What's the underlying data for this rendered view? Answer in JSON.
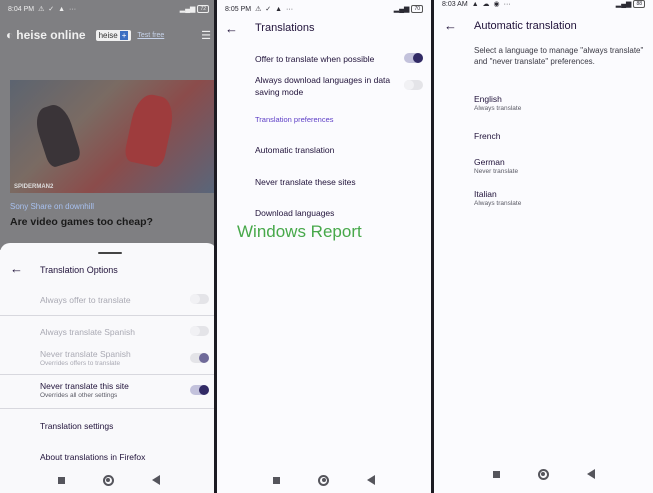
{
  "left_panel": {
    "status": {
      "time": "8:04 PM",
      "icons": "⚠ ✓ ▲",
      "more": "···",
      "battery": "72"
    },
    "webpage": {
      "site_name": "heise online",
      "plus_label": "heise",
      "plus_badge": "+",
      "test_free": "Test free",
      "image_watermark": "SPIDERMAN2",
      "kicker": "Sony Share on downhill",
      "headline": "Are video games too cheap?"
    },
    "sheet": {
      "title": "Translation Options",
      "rows": [
        {
          "title": "Always offer to translate",
          "subtitle": "",
          "toggle": "off",
          "dim": true
        },
        {
          "title": "Always translate Spanish",
          "subtitle": "",
          "toggle": "off",
          "dim": true
        },
        {
          "title": "Never translate Spanish",
          "subtitle": "Overrides offers to translate",
          "toggle": "on",
          "dim": true
        },
        {
          "title": "Never translate this site",
          "subtitle": "Overrides all other settings",
          "toggle": "on",
          "dim": false
        }
      ],
      "links": [
        "Translation settings",
        "About translations in Firefox"
      ]
    }
  },
  "middle_panel": {
    "status": {
      "time": "8:05 PM",
      "icons": "⚠ ✓ ▲",
      "more": "···",
      "battery": "70"
    },
    "title": "Translations",
    "settings": [
      {
        "label": "Offer to translate when possible",
        "toggle": "on"
      },
      {
        "label": "Always download languages in data saving mode",
        "toggle": "off"
      }
    ],
    "section_header": "Translation preferences",
    "items": [
      "Automatic translation",
      "Never translate these sites",
      "Download languages"
    ],
    "watermark": "Windows Report"
  },
  "right_panel": {
    "status": {
      "time": "8:03 AM",
      "icons": "▲ ☁ ◉",
      "more": "···",
      "battery": "88"
    },
    "title": "Automatic translation",
    "description": "Select a language to manage \"always translate\" and \"never translate\" preferences.",
    "languages": [
      {
        "name": "English",
        "status": "Always translate"
      },
      {
        "name": "French",
        "status": ""
      },
      {
        "name": "German",
        "status": "Never translate"
      },
      {
        "name": "Italian",
        "status": "Always translate"
      }
    ]
  },
  "colors": {
    "accent": "#312a65",
    "section": "#5d3ec6",
    "watermark": "#47a84a"
  }
}
